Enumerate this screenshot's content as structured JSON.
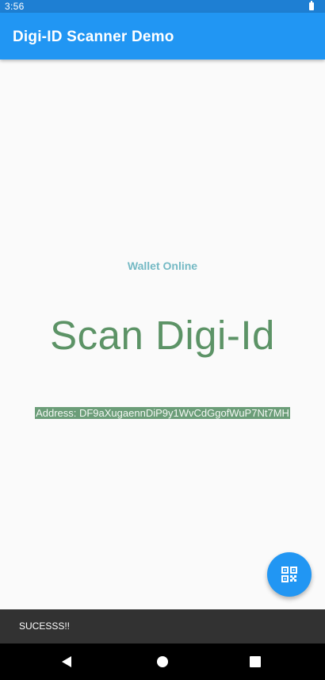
{
  "status_bar": {
    "time": "3:56",
    "battery_icon": "battery-icon"
  },
  "app_bar": {
    "title": "Digi-ID Scanner Demo"
  },
  "main": {
    "wallet_status": "Wallet Online",
    "heading": "Scan Digi-Id",
    "address": "Address: DF9aXugaennDiP9y1WvCdGgofWuP7Nt7MH"
  },
  "fab": {
    "icon": "qr-code-icon"
  },
  "snackbar": {
    "message": "SUCESSS!!"
  },
  "nav_bar": {
    "back_icon": "back-icon",
    "home_icon": "home-icon",
    "recents_icon": "recents-icon"
  },
  "colors": {
    "app_bar": "#2196f3",
    "status_bar": "#1e7fd3",
    "wallet_status": "#74b9c4",
    "heading": "#5c9366",
    "address_bg": "#6b9d78",
    "snackbar": "#323232"
  }
}
